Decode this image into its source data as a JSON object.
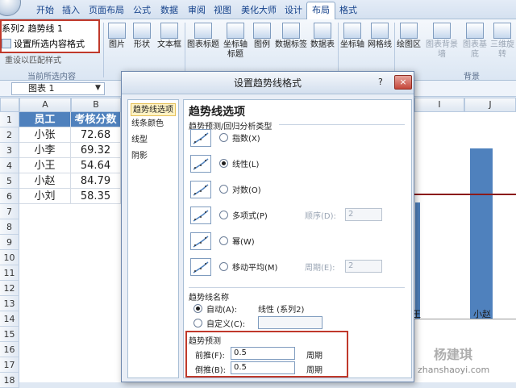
{
  "ribbon": {
    "tabs": [
      "开始",
      "插入",
      "页面布局",
      "公式",
      "数据",
      "审阅",
      "视图",
      "美化大师",
      "设计",
      "布局",
      "格式"
    ],
    "active_tab": "布局",
    "selection_value": "系列2 趋势线 1",
    "format_selection_label": "设置所选内容格式",
    "reset_style_label": "重设以匹配样式",
    "current_selection_group": "当前所选内容",
    "buttons": [
      "图片",
      "形状",
      "文本框",
      "图表标题",
      "坐标轴标题",
      "图例",
      "数据标签",
      "数据表",
      "坐标轴",
      "网格线",
      "绘图区",
      "图表背景墙",
      "图表基底",
      "三维旋转"
    ],
    "background_group": "背景"
  },
  "namebox": {
    "value": "图表 1"
  },
  "sheet": {
    "columns": [
      "A",
      "B",
      "I",
      "J"
    ],
    "rows": [
      "1",
      "2",
      "3",
      "4",
      "5",
      "6",
      "7",
      "8",
      "9",
      "10",
      "11",
      "12",
      "13",
      "14",
      "15",
      "16",
      "17",
      "18"
    ],
    "header": [
      "员工",
      "考核分数"
    ],
    "data": [
      [
        "小张",
        "72.68"
      ],
      [
        "小李",
        "69.32"
      ],
      [
        "小王",
        "54.64"
      ],
      [
        "小赵",
        "84.79"
      ],
      [
        "小刘",
        "58.35"
      ]
    ]
  },
  "chart": {
    "category_label": "小赵",
    "partial_label": "王"
  },
  "dialog": {
    "title": "设置趋势线格式",
    "help": "?",
    "close": "×",
    "nav": [
      "趋势线选项",
      "线条颜色",
      "线型",
      "阴影"
    ],
    "heading": "趋势线选项",
    "type_section": "趋势预测/回归分析类型",
    "types": [
      {
        "label": "指数(X)",
        "selected": false
      },
      {
        "label": "线性(L)",
        "selected": true
      },
      {
        "label": "对数(O)",
        "selected": false
      },
      {
        "label": "多项式(P)",
        "selected": false,
        "extra_label": "顺序(D):",
        "extra_value": "2"
      },
      {
        "label": "幂(W)",
        "selected": false
      },
      {
        "label": "移动平均(M)",
        "selected": false,
        "extra_label": "周期(E):",
        "extra_value": "2"
      }
    ],
    "name_section": "趋势线名称",
    "auto_label": "自动(A):",
    "auto_value": "线性 (系列2)",
    "custom_label": "自定义(C):",
    "forecast_section": "趋势预测",
    "forward_label": "前推(F):",
    "forward_value": "0.5",
    "backward_label": "倒推(B):",
    "backward_value": "0.5",
    "period_label": "周期"
  },
  "watermark": {
    "name": "杨建琪",
    "url": "zhanshaoyi.com"
  }
}
